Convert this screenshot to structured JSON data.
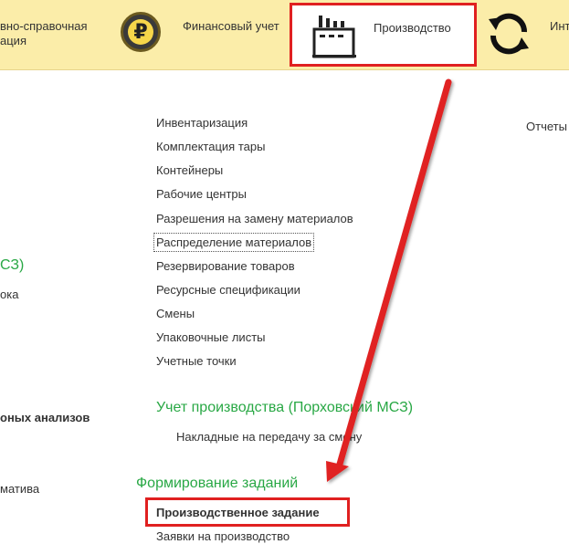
{
  "top_sections": {
    "normative_line1": "вно-справочная",
    "normative_line2": "ация",
    "finance_label": "Финансовый учет",
    "finance_icon": "ruble-icon",
    "production_label": "Производство",
    "production_icon": "factory-icon",
    "integration_label": "Инт",
    "integration_icon": "sync-arrows-icon"
  },
  "left_fragments": {
    "mcz": "СЗ)",
    "oka": "ока",
    "analyses": "оных анализов",
    "mativa": "матива"
  },
  "production_menu": {
    "items": [
      "Инвентаризация",
      "Комплектация тары",
      "Контейнеры",
      "Рабочие центры",
      "Разрешения на замену материалов",
      "Распределение материалов",
      "Резервирование товаров",
      "Ресурсные спецификации",
      "Смены",
      "Упаковочные листы",
      "Учетные точки"
    ],
    "group_accounting_title": "Учет производства (Порховский МСЗ)",
    "group_accounting_items": [
      "Накладные на передачу за смену"
    ],
    "group_tasks_title": "Формирование заданий",
    "group_tasks_items": [
      "Производственное задание",
      "Заявки на производство"
    ]
  },
  "right_column": {
    "reports": "Отчеты"
  },
  "colors": {
    "topbar_bg": "#fbeda9",
    "group_title": "#29a845",
    "annotation_red": "#e02020"
  }
}
